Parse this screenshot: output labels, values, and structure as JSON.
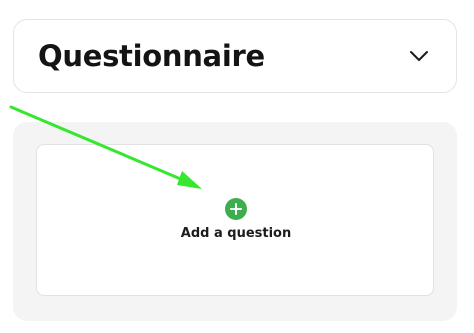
{
  "section": {
    "title": "Questionnaire",
    "toggle_icon": "chevron-down-icon"
  },
  "questions": {
    "add_label": "Add a question",
    "add_icon": "plus-icon"
  },
  "annotation": {
    "pointer_icon": "arrow-icon",
    "color": "#35e72e"
  },
  "colors": {
    "accent": "#3dae4d",
    "panel_background": "#f4f4f4"
  }
}
